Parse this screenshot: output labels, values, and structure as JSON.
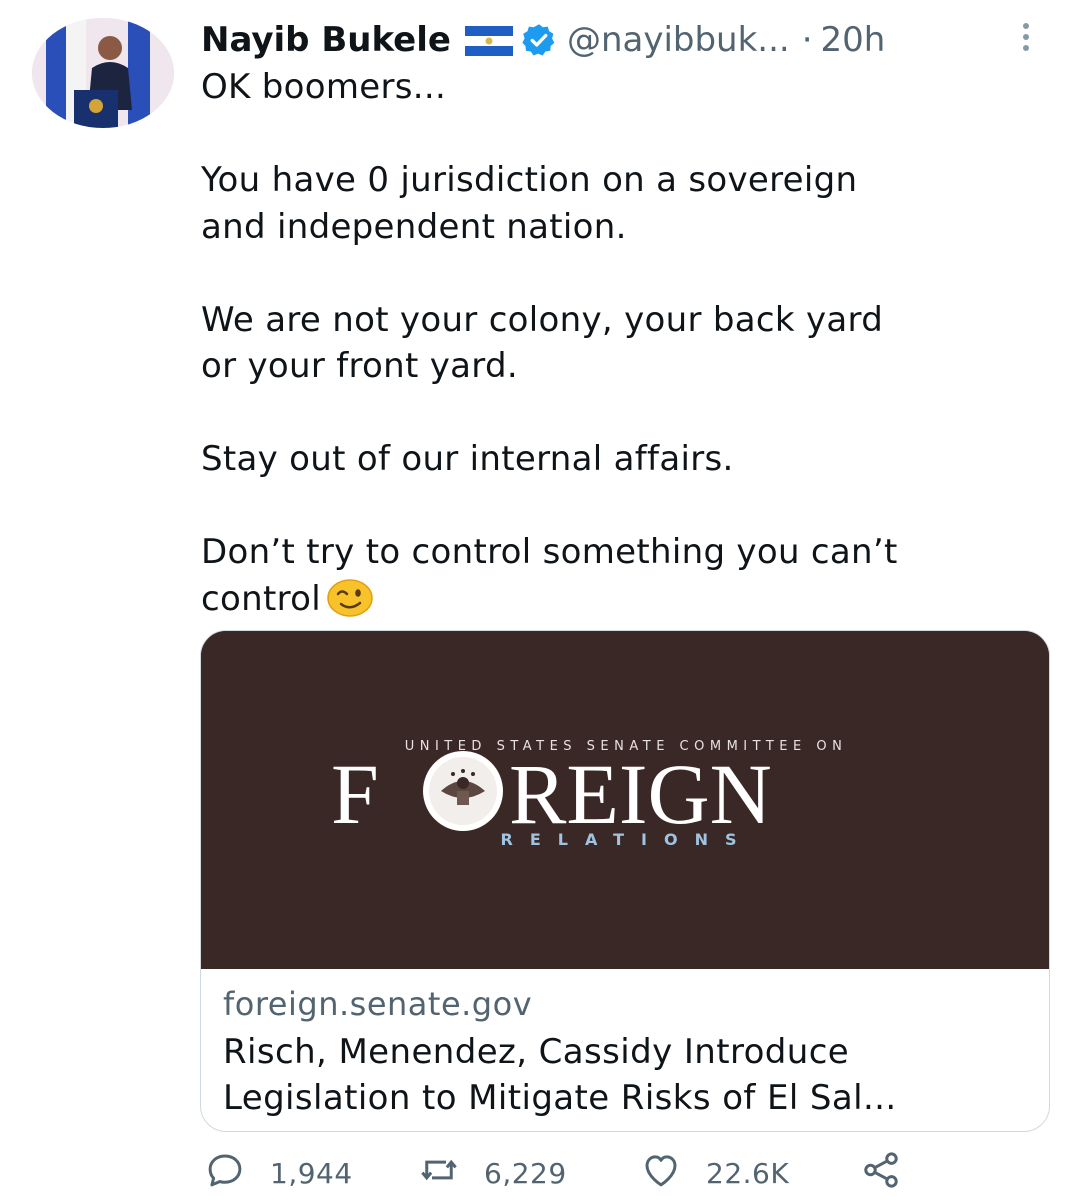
{
  "tweet": {
    "author_name": "Nayib Bukele",
    "handle": "@nayibbuk...",
    "separator": "·",
    "time": "20h",
    "lines": [
      "OK boomers...",
      "",
      "You have 0 jurisdiction on a sovereign",
      "and independent nation.",
      "",
      "We are not your colony, your back yard",
      "or your front yard.",
      "",
      "Stay out of our internal affairs.",
      "",
      "Don’t try to control something you can’t",
      "control"
    ],
    "icons": {
      "avatar": "avatar-photo",
      "flag": "el-salvador-flag-icon",
      "verified": "verified-badge-icon",
      "more": "more-options-icon",
      "emoji": "winking-face-emoji"
    }
  },
  "card": {
    "image_text": {
      "top": "UNITED STATES SENATE COMMITTEE ON",
      "main_left": "F",
      "main_right": "REIGN",
      "bottom": "RELATIONS"
    },
    "domain": "foreign.senate.gov",
    "title_line1": "Risch, Menendez, Cassidy Introduce",
    "title_line2": "Legislation to Mitigate Risks of El Sal..."
  },
  "actions": {
    "replies": "1,944",
    "retweets": "6,229",
    "likes": "22.6K",
    "icons": [
      "reply-icon",
      "retweet-icon",
      "like-icon",
      "share-icon"
    ]
  },
  "colors": {
    "text": "#0f1419",
    "secondary": "#536471",
    "verified_blue": "#1d9bf0",
    "card_bg": "#3a2826",
    "card_accent": "#9fc3e0",
    "border": "#cfd9de"
  }
}
